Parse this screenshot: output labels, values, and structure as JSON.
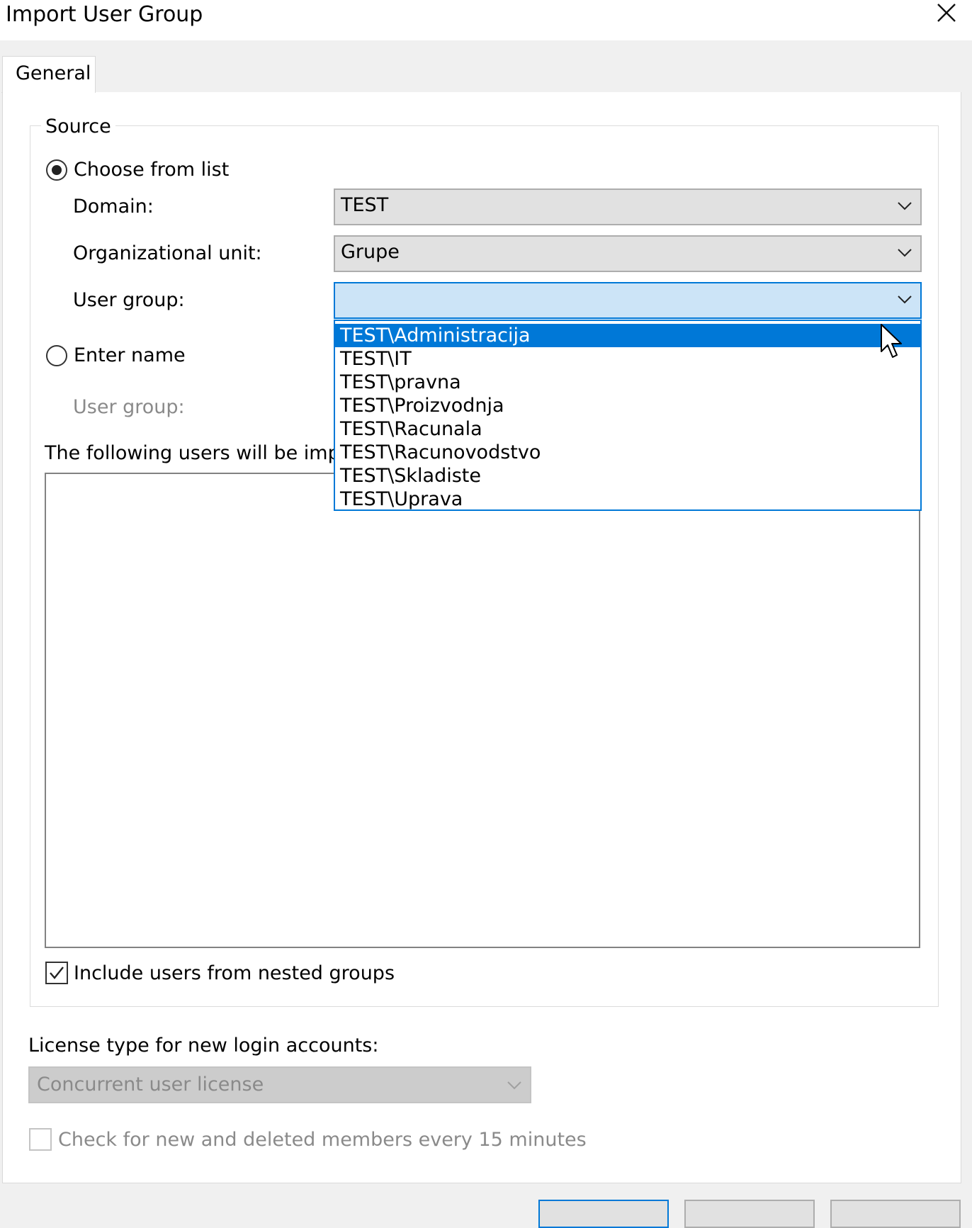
{
  "window": {
    "title": "Import User Group",
    "close_icon": "close-icon"
  },
  "tabs": [
    {
      "label": "General",
      "active": true
    }
  ],
  "source": {
    "legend": "Source",
    "choose_from_list": {
      "label": "Choose from list",
      "selected": true
    },
    "domain": {
      "label": "Domain:",
      "value": "TEST"
    },
    "organizational_unit": {
      "label": "Organizational unit:",
      "value": "Grupe"
    },
    "user_group": {
      "label": "User group:",
      "value": "",
      "dropdown_open": true,
      "options": [
        "TEST\\Administracija",
        "TEST\\IT",
        "TEST\\pravna",
        "TEST\\Proizvodnja",
        "TEST\\Racunala",
        "TEST\\Racunovodstvo",
        "TEST\\Skladiste",
        "TEST\\Uprava"
      ],
      "highlighted_option": "TEST\\Administracija"
    },
    "enter_name": {
      "label": "Enter name",
      "selected": false
    },
    "enter_user_group": {
      "label": "User group:",
      "disabled": true
    },
    "users_list_label": "The following users will be imp",
    "include_nested": {
      "label": "Include users from nested groups",
      "checked": true
    }
  },
  "license": {
    "label": "License type for new login accounts:",
    "value": "Concurrent user license",
    "disabled": true
  },
  "check_members": {
    "label": "Check for new and deleted members every 15 minutes",
    "checked": false,
    "disabled": true
  },
  "colors": {
    "accent": "#0078d7",
    "selection_bg": "#0078d7",
    "combo_active_bg": "#cce4f7",
    "disabled_text": "#8a8a8a"
  }
}
